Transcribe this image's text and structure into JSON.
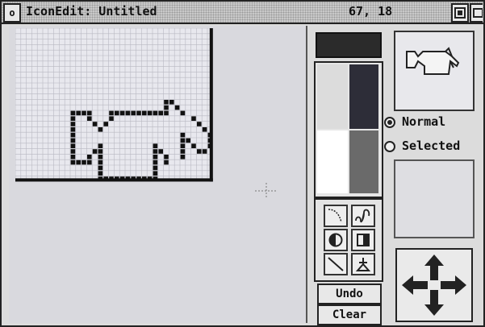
{
  "window": {
    "title": "IconEdit: Untitled",
    "coords": "67, 18",
    "back_glyph": "o",
    "toggle_glyph": "▣"
  },
  "icon_pixels": [
    "....................................",
    "....................................",
    "....................................",
    "....................................",
    "....................................",
    "....................................",
    "....................................",
    "....................................",
    "....................................",
    "....................................",
    "....................................",
    "....................................",
    "....................................",
    "...........................##.......",
    "...........................#.#......",
    "..........####...###########..#.....",
    "..........#..#...#..............#...",
    "..........#...#.#................#..",
    "..........#....#..................#.",
    "..........#...................#....#",
    "..........#...................##...#",
    "..........#....#.........#....#.#..#",
    "..........#...##.........##...#..##.",
    "..........#..#.#.........#.#..#.....",
    "..........####.#.........#.#........",
    "...............#.........#..........",
    "...............#.........#..........",
    "...............###########.........."
  ],
  "palette": {
    "swatches": [
      "lightgrey",
      "black",
      "white",
      "darkgrey"
    ],
    "current_colour": "#2b2b2b"
  },
  "tools": [
    {
      "name": "curve-tool",
      "icon": "curve-icon"
    },
    {
      "name": "freehand-tool",
      "icon": "squiggle-icon"
    },
    {
      "name": "circle-tool",
      "icon": "circle-icon"
    },
    {
      "name": "rectangle-tool",
      "icon": "rectangle-icon"
    },
    {
      "name": "line-tool",
      "icon": "line-icon"
    },
    {
      "name": "fill-tool",
      "icon": "fill-icon"
    }
  ],
  "buttons": {
    "undo": "Undo",
    "clear": "Clear"
  },
  "options": {
    "normal": "Normal",
    "selected": "Selected",
    "current": "Normal"
  },
  "colors": {
    "grid_pixel": "#111111",
    "grid_line": "#b8b8c2",
    "grid_bg": "#e8e8ee"
  }
}
